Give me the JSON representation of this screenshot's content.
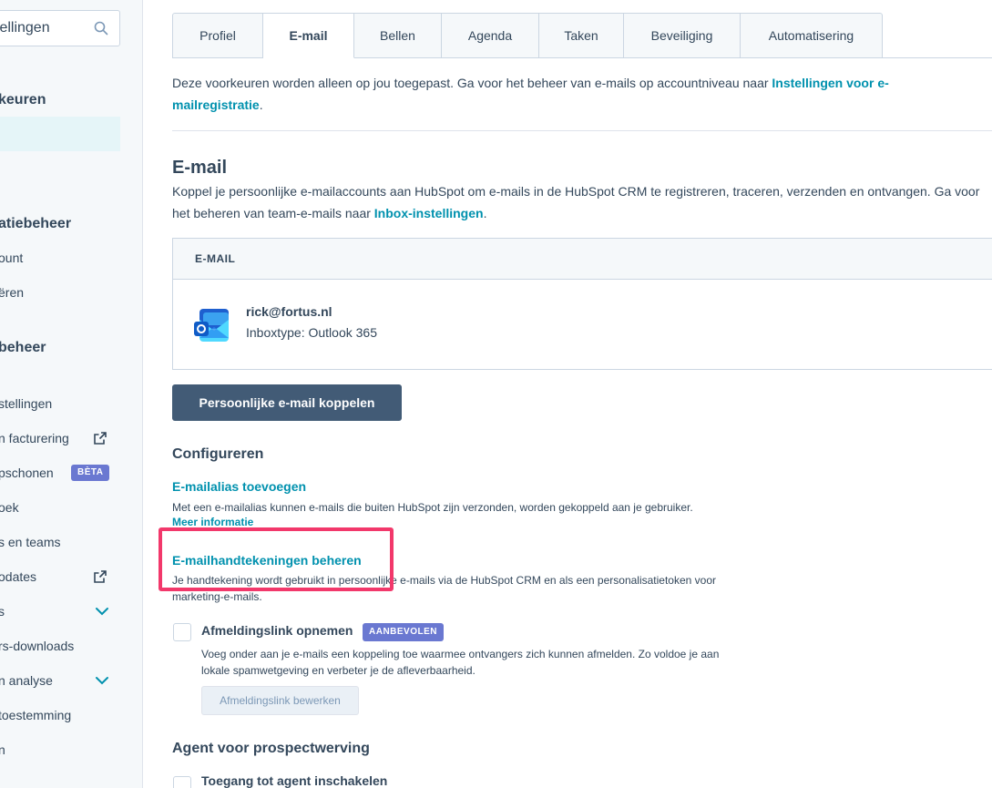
{
  "sidebar": {
    "search_text": "tellingen",
    "heading_preferences": "keuren",
    "heading_account": "atiebeheer",
    "account_items": [
      "ount",
      "ëren"
    ],
    "heading_data": "beheer",
    "data_items": [
      "stellingen",
      "n facturering",
      "pschonen",
      "oek",
      "s en teams",
      "odates",
      "s",
      "rs-downloads",
      "n analyse",
      "toestemming",
      "n"
    ],
    "beta_badge": "BÈTA"
  },
  "tabs": [
    "Profiel",
    "E-mail",
    "Bellen",
    "Agenda",
    "Taken",
    "Beveiliging",
    "Automatisering"
  ],
  "intro": {
    "text": "Deze voorkeuren worden alleen op jou toegepast. Ga voor het beheer van e-mails op accountniveau naar ",
    "link": "Instellingen voor e-mailregistratie",
    "end": "."
  },
  "email_section": {
    "title": "E-mail",
    "desc": "Koppel je persoonlijke e-mailaccounts aan HubSpot om e-mails in de HubSpot CRM te registreren, traceren, verzenden en ontvangen. Ga voor het beheren van team-e-mails naar ",
    "desc_link": "Inbox-instellingen",
    "desc_end": ".",
    "table_header": "E-MAIL",
    "account_email": "rick@fortus.nl",
    "account_type": "Inboxtype: Outlook 365",
    "connect_button": "Persoonlijke e-mail koppelen"
  },
  "configure": {
    "title": "Configureren",
    "alias_link": "E-mailalias toevoegen",
    "alias_desc": "Met een e-mailalias kunnen e-mails die buiten HubSpot zijn verzonden, worden gekoppeld aan je gebruiker.",
    "more_info": "Meer informatie",
    "signature_link": "E-mailhandtekeningen beheren",
    "signature_desc": "Je handtekening wordt gebruikt in persoonlijke e-mails via de HubSpot CRM en als een personalisatietoken voor marketing-e-mails.",
    "unsub_label": "Afmeldingslink opnemen",
    "unsub_badge": "AANBEVOLEN",
    "unsub_desc": "Voeg onder aan je e-mails een koppeling toe waarmee ontvangers zich kunnen afmelden. Zo voldoe je aan lokale spamwetgeving en verbeter je de afleverbaarheid.",
    "unsub_edit_button": "Afmeldingslink bewerken"
  },
  "agent": {
    "title": "Agent voor prospectwerving",
    "enable_label": "Toegang tot agent inschakelen"
  },
  "colors": {
    "link": "#0091ae",
    "primary_button": "#425b76",
    "badge": "#6a78d1",
    "highlight": "#f2386b",
    "active_sidebar": "#e5f5f8"
  }
}
